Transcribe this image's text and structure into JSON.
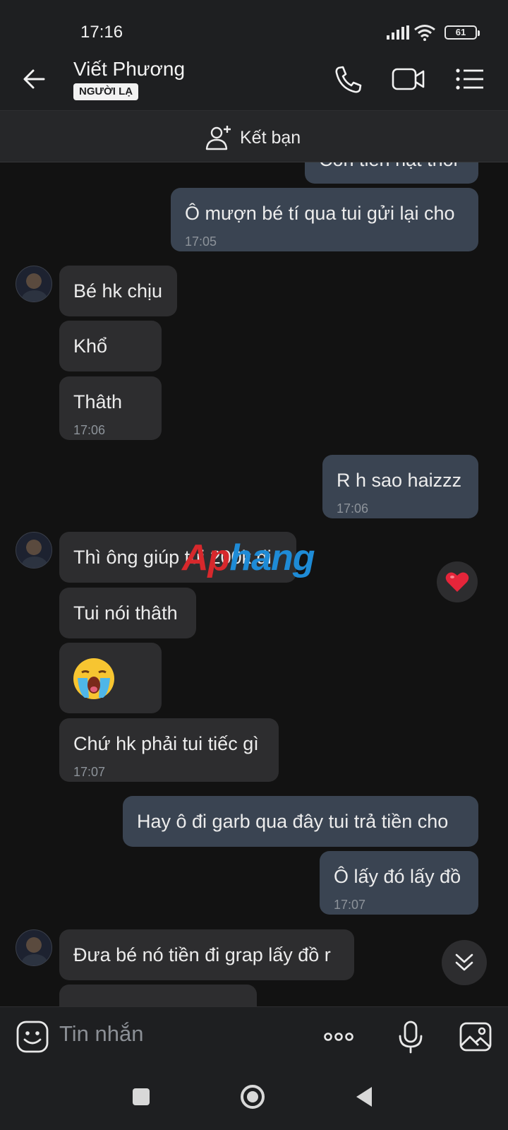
{
  "status_bar": {
    "time": "17:16",
    "battery": "61"
  },
  "header": {
    "contact_name": "Viết Phương",
    "badge": "NGƯỜI LẠ"
  },
  "add_friend": {
    "label": "Kết bạn"
  },
  "messages": [
    {
      "id": "m0",
      "dir": "out",
      "text": "Còn tiền hạt thôi",
      "time": ""
    },
    {
      "id": "m1",
      "dir": "out",
      "text": "Ô mượn bé tí qua tui gửi lại cho",
      "time": "17:05"
    },
    {
      "id": "m2",
      "dir": "in",
      "text": "Bé hk chịu",
      "time": ""
    },
    {
      "id": "m3",
      "dir": "in",
      "text": "Khổ",
      "time": ""
    },
    {
      "id": "m4",
      "dir": "in",
      "text": "Thâth",
      "time": "17:06"
    },
    {
      "id": "m5",
      "dir": "out",
      "text": "R h sao haizzz",
      "time": "17:06"
    },
    {
      "id": "m6",
      "dir": "in",
      "text": "Thì ông giúp tui 200k đi",
      "time": ""
    },
    {
      "id": "m7",
      "dir": "in",
      "text": "Tui nói thâth",
      "time": ""
    },
    {
      "id": "m8",
      "dir": "in",
      "text": "",
      "sticker": "crying-face-emoji",
      "time": ""
    },
    {
      "id": "m9",
      "dir": "in",
      "text": "Chứ hk phải tui tiếc gì",
      "time": "17:07"
    },
    {
      "id": "m10",
      "dir": "out",
      "text": "Hay ô đi garb qua đây tui trả tiền cho",
      "time": ""
    },
    {
      "id": "m11",
      "dir": "out",
      "text": "Ô lấy đó lấy đồ",
      "time": "17:07"
    },
    {
      "id": "m12",
      "dir": "in",
      "text": "Đưa bé nó tiền đi grap lấy đồ r",
      "time": ""
    }
  ],
  "reaction": {
    "emoji": "❤",
    "icon": "heart-icon",
    "color": "#e5253a"
  },
  "watermark": {
    "part_a": "Ap",
    "part_b": "hang"
  },
  "composer": {
    "placeholder": "Tin nhắn"
  },
  "colors": {
    "incoming_bubble": "#2d2d2f",
    "outgoing_bubble": "#3a4452",
    "background": "#121212"
  }
}
